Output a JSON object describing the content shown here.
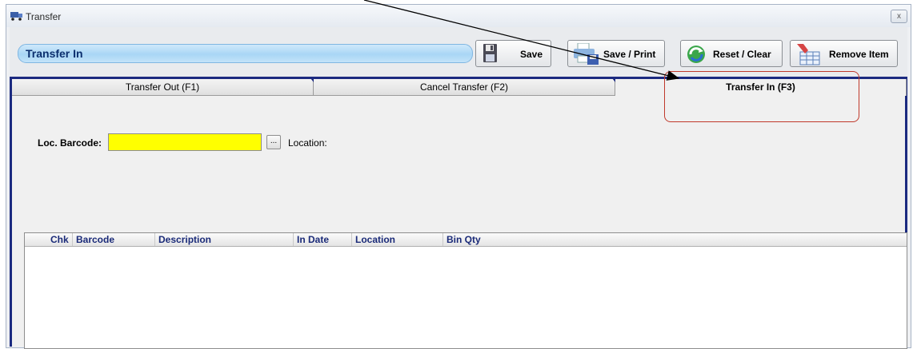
{
  "window": {
    "title": "Transfer",
    "close_symbol": "x"
  },
  "header": {
    "form_title": "Transfer In",
    "buttons": {
      "save_label": "Save",
      "save_print_label": "Save / Print",
      "reset_label": "Reset / Clear",
      "remove_item_label": "Remove Item"
    }
  },
  "tabs": [
    {
      "label": "Transfer Out (F1)",
      "active": false
    },
    {
      "label": "Cancel Transfer (F2)",
      "active": false
    },
    {
      "label": "Transfer In (F3)",
      "active": true
    }
  ],
  "form": {
    "loc_barcode_label": "Loc. Barcode:",
    "loc_barcode_value": "",
    "browse_label": "...",
    "location_label": "Location:"
  },
  "grid": {
    "columns": [
      "Chk",
      "Barcode",
      "Description",
      "In Date",
      "Location",
      "Bin Qty"
    ],
    "rows": []
  },
  "colors": {
    "accent_navy": "#1b2a80",
    "input_highlight": "#ffff00",
    "annotation_red": "#c0392b"
  }
}
